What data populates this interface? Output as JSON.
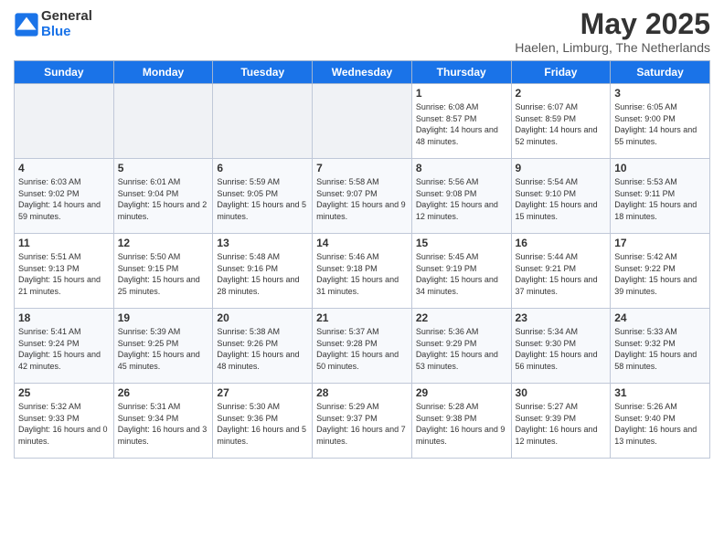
{
  "header": {
    "logo_general": "General",
    "logo_blue": "Blue",
    "month_title": "May 2025",
    "location": "Haelen, Limburg, The Netherlands"
  },
  "weekdays": [
    "Sunday",
    "Monday",
    "Tuesday",
    "Wednesday",
    "Thursday",
    "Friday",
    "Saturday"
  ],
  "weeks": [
    [
      {
        "day": "",
        "empty": true
      },
      {
        "day": "",
        "empty": true
      },
      {
        "day": "",
        "empty": true
      },
      {
        "day": "",
        "empty": true
      },
      {
        "day": "1",
        "sunrise": "6:08 AM",
        "sunset": "8:57 PM",
        "daylight": "14 hours and 48 minutes."
      },
      {
        "day": "2",
        "sunrise": "6:07 AM",
        "sunset": "8:59 PM",
        "daylight": "14 hours and 52 minutes."
      },
      {
        "day": "3",
        "sunrise": "6:05 AM",
        "sunset": "9:00 PM",
        "daylight": "14 hours and 55 minutes."
      }
    ],
    [
      {
        "day": "4",
        "sunrise": "6:03 AM",
        "sunset": "9:02 PM",
        "daylight": "14 hours and 59 minutes."
      },
      {
        "day": "5",
        "sunrise": "6:01 AM",
        "sunset": "9:04 PM",
        "daylight": "15 hours and 2 minutes."
      },
      {
        "day": "6",
        "sunrise": "5:59 AM",
        "sunset": "9:05 PM",
        "daylight": "15 hours and 5 minutes."
      },
      {
        "day": "7",
        "sunrise": "5:58 AM",
        "sunset": "9:07 PM",
        "daylight": "15 hours and 9 minutes."
      },
      {
        "day": "8",
        "sunrise": "5:56 AM",
        "sunset": "9:08 PM",
        "daylight": "15 hours and 12 minutes."
      },
      {
        "day": "9",
        "sunrise": "5:54 AM",
        "sunset": "9:10 PM",
        "daylight": "15 hours and 15 minutes."
      },
      {
        "day": "10",
        "sunrise": "5:53 AM",
        "sunset": "9:11 PM",
        "daylight": "15 hours and 18 minutes."
      }
    ],
    [
      {
        "day": "11",
        "sunrise": "5:51 AM",
        "sunset": "9:13 PM",
        "daylight": "15 hours and 21 minutes."
      },
      {
        "day": "12",
        "sunrise": "5:50 AM",
        "sunset": "9:15 PM",
        "daylight": "15 hours and 25 minutes."
      },
      {
        "day": "13",
        "sunrise": "5:48 AM",
        "sunset": "9:16 PM",
        "daylight": "15 hours and 28 minutes."
      },
      {
        "day": "14",
        "sunrise": "5:46 AM",
        "sunset": "9:18 PM",
        "daylight": "15 hours and 31 minutes."
      },
      {
        "day": "15",
        "sunrise": "5:45 AM",
        "sunset": "9:19 PM",
        "daylight": "15 hours and 34 minutes."
      },
      {
        "day": "16",
        "sunrise": "5:44 AM",
        "sunset": "9:21 PM",
        "daylight": "15 hours and 37 minutes."
      },
      {
        "day": "17",
        "sunrise": "5:42 AM",
        "sunset": "9:22 PM",
        "daylight": "15 hours and 39 minutes."
      }
    ],
    [
      {
        "day": "18",
        "sunrise": "5:41 AM",
        "sunset": "9:24 PM",
        "daylight": "15 hours and 42 minutes."
      },
      {
        "day": "19",
        "sunrise": "5:39 AM",
        "sunset": "9:25 PM",
        "daylight": "15 hours and 45 minutes."
      },
      {
        "day": "20",
        "sunrise": "5:38 AM",
        "sunset": "9:26 PM",
        "daylight": "15 hours and 48 minutes."
      },
      {
        "day": "21",
        "sunrise": "5:37 AM",
        "sunset": "9:28 PM",
        "daylight": "15 hours and 50 minutes."
      },
      {
        "day": "22",
        "sunrise": "5:36 AM",
        "sunset": "9:29 PM",
        "daylight": "15 hours and 53 minutes."
      },
      {
        "day": "23",
        "sunrise": "5:34 AM",
        "sunset": "9:30 PM",
        "daylight": "15 hours and 56 minutes."
      },
      {
        "day": "24",
        "sunrise": "5:33 AM",
        "sunset": "9:32 PM",
        "daylight": "15 hours and 58 minutes."
      }
    ],
    [
      {
        "day": "25",
        "sunrise": "5:32 AM",
        "sunset": "9:33 PM",
        "daylight": "16 hours and 0 minutes."
      },
      {
        "day": "26",
        "sunrise": "5:31 AM",
        "sunset": "9:34 PM",
        "daylight": "16 hours and 3 minutes."
      },
      {
        "day": "27",
        "sunrise": "5:30 AM",
        "sunset": "9:36 PM",
        "daylight": "16 hours and 5 minutes."
      },
      {
        "day": "28",
        "sunrise": "5:29 AM",
        "sunset": "9:37 PM",
        "daylight": "16 hours and 7 minutes."
      },
      {
        "day": "29",
        "sunrise": "5:28 AM",
        "sunset": "9:38 PM",
        "daylight": "16 hours and 9 minutes."
      },
      {
        "day": "30",
        "sunrise": "5:27 AM",
        "sunset": "9:39 PM",
        "daylight": "16 hours and 12 minutes."
      },
      {
        "day": "31",
        "sunrise": "5:26 AM",
        "sunset": "9:40 PM",
        "daylight": "16 hours and 13 minutes."
      }
    ]
  ]
}
